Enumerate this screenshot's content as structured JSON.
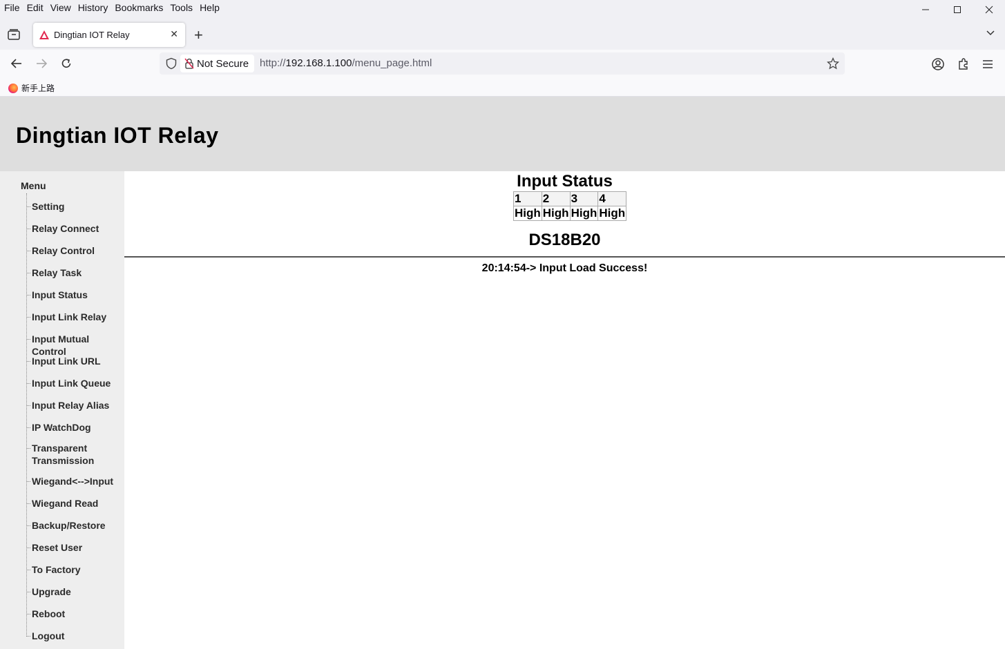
{
  "browser": {
    "menu": [
      "File",
      "Edit",
      "View",
      "History",
      "Bookmarks",
      "Tools",
      "Help"
    ],
    "tab_title": "Dingtian IOT Relay",
    "new_tab_symbol": "+",
    "not_secure_label": "Not Secure",
    "url_prefix": "http://",
    "url_host": "192.168.1.100",
    "url_path": "/menu_page.html",
    "bookmark_label": "新手上路"
  },
  "page": {
    "banner_title": "Dingtian IOT Relay",
    "menu_title": "Menu",
    "menu_items": [
      "Setting",
      "Relay Connect",
      "Relay Control",
      "Relay Task",
      "Input Status",
      "Input Link Relay",
      "Input Mutual Control",
      "Input Link URL",
      "Input Link Queue",
      "Input Relay Alias",
      "IP WatchDog",
      "Transparent Transmission",
      "Wiegand<-->Input",
      "Wiegand Read",
      "Backup/Restore",
      "Reset User",
      "To Factory",
      "Upgrade",
      "Reboot",
      "Logout"
    ],
    "input_status_title": "Input Status",
    "inputs": {
      "headers": [
        "1",
        "2",
        "3",
        "4"
      ],
      "values": [
        "High",
        "High",
        "High",
        "High"
      ]
    },
    "ds18b20_title": "DS18B20",
    "status_message": "20:14:54-> Input Load Success!"
  }
}
